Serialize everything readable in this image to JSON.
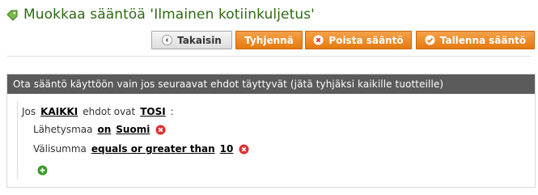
{
  "header": {
    "title": "Muokkaa sääntöä 'Ilmainen kotiinkuljetus'",
    "title_icon": "tag-icon"
  },
  "toolbar": {
    "back_label": "Takaisin",
    "clear_label": "Tyhjennä",
    "delete_label": "Poista sääntö",
    "save_label": "Tallenna sääntö"
  },
  "panel": {
    "header": "Ota sääntö käyttöön vain jos seuraavat ehdot täyttyvät (jätä tyhjäksi kaikille tuotteille)",
    "root": {
      "prefix": "Jos",
      "aggregator": "KAIKKI",
      "middle": "ehdot ovat",
      "value": "TOSI",
      "suffix": ":"
    },
    "conditions": [
      {
        "attribute": "Lähetysmaa",
        "operator": "on",
        "value": "Suomi"
      },
      {
        "attribute": "Välisumma",
        "operator": "equals or greater than",
        "value": "10"
      }
    ]
  },
  "colors": {
    "title": "#2e6a12",
    "accent_orange": "#e57a10",
    "header_bg": "#5b5b5b",
    "delete_red": "#e03030",
    "add_green": "#3a9a2a"
  }
}
